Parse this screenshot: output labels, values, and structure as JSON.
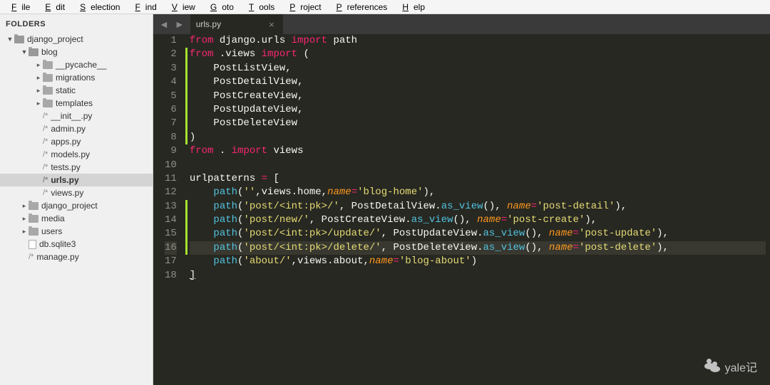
{
  "menu": [
    "File",
    "Edit",
    "Selection",
    "Find",
    "View",
    "Goto",
    "Tools",
    "Project",
    "Preferences",
    "Help"
  ],
  "sidebar": {
    "header": "FOLDERS",
    "tree": [
      {
        "d": 0,
        "type": "folder-open",
        "label": "django_project"
      },
      {
        "d": 1,
        "type": "folder-open",
        "label": "blog"
      },
      {
        "d": 2,
        "type": "folder",
        "label": "__pycache__"
      },
      {
        "d": 2,
        "type": "folder",
        "label": "migrations"
      },
      {
        "d": 2,
        "type": "folder",
        "label": "static"
      },
      {
        "d": 2,
        "type": "folder",
        "label": "templates"
      },
      {
        "d": 2,
        "type": "file",
        "label": "__init__.py"
      },
      {
        "d": 2,
        "type": "file",
        "label": "admin.py"
      },
      {
        "d": 2,
        "type": "file",
        "label": "apps.py"
      },
      {
        "d": 2,
        "type": "file",
        "label": "models.py"
      },
      {
        "d": 2,
        "type": "file",
        "label": "tests.py"
      },
      {
        "d": 2,
        "type": "file",
        "label": "urls.py",
        "selected": true
      },
      {
        "d": 2,
        "type": "file",
        "label": "views.py"
      },
      {
        "d": 1,
        "type": "folder",
        "label": "django_project"
      },
      {
        "d": 1,
        "type": "folder",
        "label": "media"
      },
      {
        "d": 1,
        "type": "folder",
        "label": "users"
      },
      {
        "d": 1,
        "type": "dbfile",
        "label": "db.sqlite3"
      },
      {
        "d": 1,
        "type": "file",
        "label": "manage.py"
      }
    ]
  },
  "tab": {
    "name": "urls.py",
    "close": "×"
  },
  "lines": [
    {
      "n": 1,
      "html": "<span class='k-red'>from</span> django.urls <span class='k-red'>import</span> path"
    },
    {
      "n": 2,
      "m": true,
      "html": "<span class='k-red'>from</span> .views <span class='k-red'>import</span> ("
    },
    {
      "n": 3,
      "m": true,
      "html": "    PostListView,"
    },
    {
      "n": 4,
      "m": true,
      "html": "    PostDetailView,"
    },
    {
      "n": 5,
      "m": true,
      "html": "    PostCreateView,"
    },
    {
      "n": 6,
      "m": true,
      "html": "    PostUpdateView,"
    },
    {
      "n": 7,
      "m": true,
      "html": "    PostDeleteView"
    },
    {
      "n": 8,
      "m": true,
      "html": ")"
    },
    {
      "n": 9,
      "html": "<span class='k-red'>from</span> . <span class='k-red'>import</span> views"
    },
    {
      "n": 10,
      "html": ""
    },
    {
      "n": 11,
      "html": "urlpatterns <span class='k-red'>=</span> ["
    },
    {
      "n": 12,
      "html": "    <span class='k-blue'>path</span>(<span class='k-str'>''</span>,views.home,<span class='k-orange'>name</span><span class='k-red'>=</span><span class='k-str'>'blog-home'</span>),"
    },
    {
      "n": 13,
      "m": true,
      "html": "    <span class='k-blue'>path</span>(<span class='k-str'>'post/&lt;int:pk&gt;/'</span>, PostDetailView.<span class='k-blue'>as_view</span>(), <span class='k-orange'>name</span><span class='k-red'>=</span><span class='k-str'>'post-detail'</span>),"
    },
    {
      "n": 14,
      "m": true,
      "html": "    <span class='k-blue'>path</span>(<span class='k-str'>'post/new/'</span>, PostCreateView.<span class='k-blue'>as_view</span>(), <span class='k-orange'>name</span><span class='k-red'>=</span><span class='k-str'>'post-create'</span>),"
    },
    {
      "n": 15,
      "m": true,
      "html": "    <span class='k-blue'>path</span>(<span class='k-str'>'post/&lt;int:pk&gt;/update/'</span>, PostUpdateView.<span class='k-blue'>as_view</span>(), <span class='k-orange'>name</span><span class='k-red'>=</span><span class='k-str'>'post-update'</span>),"
    },
    {
      "n": 16,
      "m": true,
      "hl": true,
      "html": "    <span class='k-blue'>path</span>(<span class='k-str'>'post/&lt;int:pk&gt;/delete/'</span>, PostDeleteView.<span class='k-blue'>as_view</span>(), <span class='k-orange'>name</span><span class='k-red'>=</span><span class='k-str'>'post-delete'</span>),"
    },
    {
      "n": 17,
      "html": "    <span class='k-blue'>path</span>(<span class='k-str'>'about/'</span>,views.about,<span class='k-orange'>name</span><span class='k-red'>=</span><span class='k-str'>'blog-about'</span>)"
    },
    {
      "n": 18,
      "html": "<span style='text-decoration:underline'>]</span>"
    }
  ],
  "watermark": "yale记"
}
